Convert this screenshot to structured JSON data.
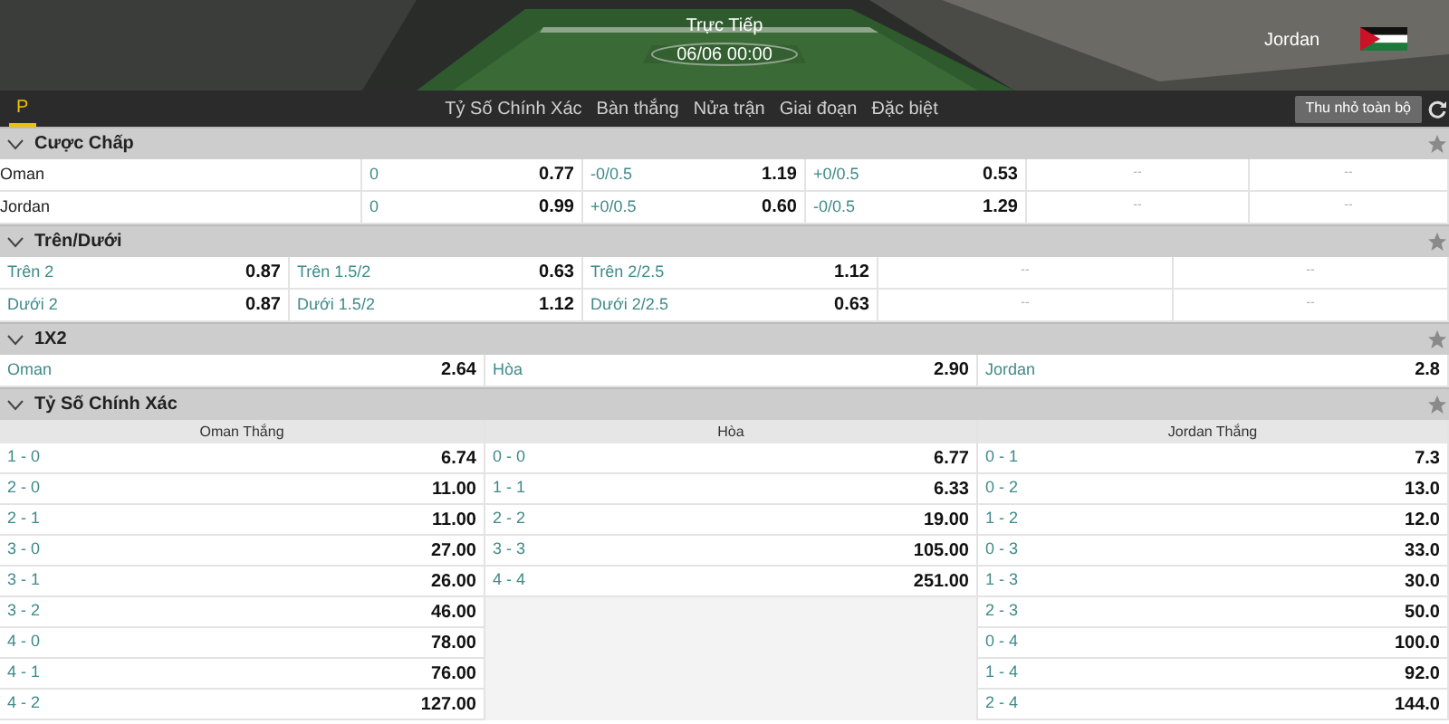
{
  "header": {
    "status": "Trực Tiếp",
    "time": "06/06 00:00",
    "away_team": "Jordan"
  },
  "tabs": [
    {
      "label": "P",
      "selected": true
    },
    {
      "label": "Tỷ Số Chính Xác",
      "selected": false
    },
    {
      "label": "Bàn thắng",
      "selected": false
    },
    {
      "label": "Nửa trận",
      "selected": false
    },
    {
      "label": "Giai đoạn",
      "selected": false
    },
    {
      "label": "Đặc biệt",
      "selected": false
    }
  ],
  "collapse_button": "Thu nhỏ toàn bộ",
  "sections": [
    {
      "kind": "handicap",
      "title": "Cược Chấp",
      "rows": [
        {
          "cells": [
            {
              "kind": "label",
              "text": "Oman"
            },
            {
              "kind": "pair",
              "label": "0",
              "odds": "0.77"
            },
            {
              "kind": "pair",
              "label": "-0/0.5",
              "odds": "1.19"
            },
            {
              "kind": "pair",
              "label": "+0/0.5",
              "odds": "0.53"
            },
            {
              "kind": "empty",
              "text": "--"
            },
            {
              "kind": "empty",
              "text": "--"
            }
          ]
        },
        {
          "cells": [
            {
              "kind": "label",
              "text": "Jordan"
            },
            {
              "kind": "pair",
              "label": "0",
              "odds": "0.99"
            },
            {
              "kind": "pair",
              "label": "+0/0.5",
              "odds": "0.60"
            },
            {
              "kind": "pair",
              "label": "-0/0.5",
              "odds": "1.29"
            },
            {
              "kind": "empty",
              "text": "--"
            },
            {
              "kind": "empty",
              "text": "--"
            }
          ]
        }
      ]
    },
    {
      "kind": "overunder",
      "title": "Trên/Dưới",
      "rows": [
        {
          "cells": [
            {
              "kind": "pair",
              "label": "Trên 2",
              "odds": "0.87"
            },
            {
              "kind": "pair",
              "label": "Trên 1.5/2",
              "odds": "0.63"
            },
            {
              "kind": "pair",
              "label": "Trên 2/2.5",
              "odds": "1.12"
            },
            {
              "kind": "empty",
              "text": "--"
            },
            {
              "kind": "empty",
              "text": "--"
            }
          ]
        },
        {
          "cells": [
            {
              "kind": "pair",
              "label": "Dưới 2",
              "odds": "0.87"
            },
            {
              "kind": "pair",
              "label": "Dưới 1.5/2",
              "odds": "1.12"
            },
            {
              "kind": "pair",
              "label": "Dưới 2/2.5",
              "odds": "0.63"
            },
            {
              "kind": "empty",
              "text": "--"
            },
            {
              "kind": "empty",
              "text": "--"
            }
          ]
        }
      ]
    },
    {
      "kind": "onex2",
      "title": "1X2",
      "rows": [
        {
          "cells": [
            {
              "kind": "pair",
              "label": "Oman",
              "odds": "2.64"
            },
            {
              "kind": "pair",
              "label": "Hòa",
              "odds": "2.90"
            },
            {
              "kind": "pair",
              "label": "Jordan",
              "odds": "2.8"
            }
          ]
        }
      ]
    },
    {
      "kind": "correct_score",
      "title": "Tỷ Số Chính Xác",
      "columns": [
        {
          "header": "Oman Thắng",
          "rows": [
            {
              "label": "1 - 0",
              "odds": "6.74"
            },
            {
              "label": "2 - 0",
              "odds": "11.00"
            },
            {
              "label": "2 - 1",
              "odds": "11.00"
            },
            {
              "label": "3 - 0",
              "odds": "27.00"
            },
            {
              "label": "3 - 1",
              "odds": "26.00"
            },
            {
              "label": "3 - 2",
              "odds": "46.00"
            },
            {
              "label": "4 - 0",
              "odds": "78.00"
            },
            {
              "label": "4 - 1",
              "odds": "76.00"
            },
            {
              "label": "4 - 2",
              "odds": "127.00"
            }
          ]
        },
        {
          "header": "Hòa",
          "rows": [
            {
              "label": "0 - 0",
              "odds": "6.77"
            },
            {
              "label": "1 - 1",
              "odds": "6.33"
            },
            {
              "label": "2 - 2",
              "odds": "19.00"
            },
            {
              "label": "3 - 3",
              "odds": "105.00"
            },
            {
              "label": "4 - 4",
              "odds": "251.00"
            }
          ]
        },
        {
          "header": "Jordan Thắng",
          "rows": [
            {
              "label": "0 - 1",
              "odds": "7.3"
            },
            {
              "label": "0 - 2",
              "odds": "13.0"
            },
            {
              "label": "1 - 2",
              "odds": "12.0"
            },
            {
              "label": "0 - 3",
              "odds": "33.0"
            },
            {
              "label": "1 - 3",
              "odds": "30.0"
            },
            {
              "label": "2 - 3",
              "odds": "50.0"
            },
            {
              "label": "0 - 4",
              "odds": "100.0"
            },
            {
              "label": "1 - 4",
              "odds": "92.0"
            },
            {
              "label": "2 - 4",
              "odds": "144.0"
            }
          ]
        }
      ]
    }
  ]
}
